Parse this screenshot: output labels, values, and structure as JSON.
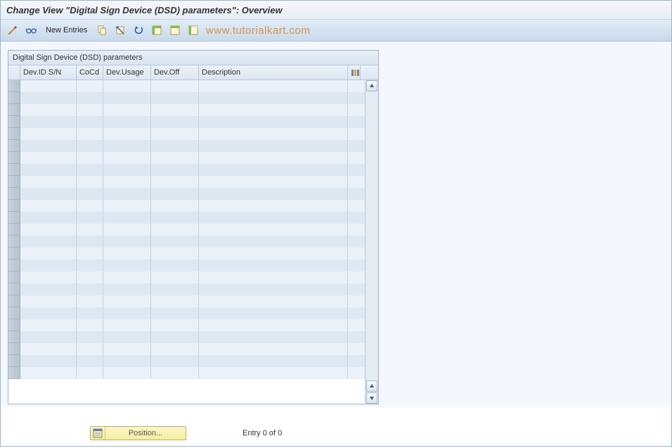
{
  "header": {
    "title": "Change View \"Digital Sign Device (DSD) parameters\": Overview"
  },
  "toolbar": {
    "new_entries_label": "New Entries"
  },
  "watermark": "www.tutorialkart.com",
  "panel": {
    "title": "Digital Sign Device (DSD) parameters",
    "columns": {
      "devid": "Dev.ID S/N",
      "cocd": "CoCd",
      "usage": "Dev.Usage",
      "off": "Dev.Off",
      "desc": "Description"
    },
    "row_count": 25
  },
  "footer": {
    "position_label": "Position...",
    "entry_label": "Entry 0 of 0"
  }
}
